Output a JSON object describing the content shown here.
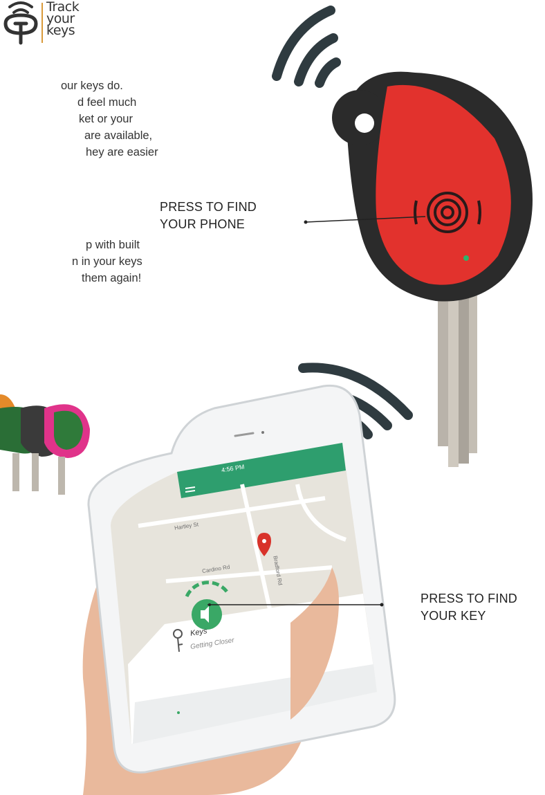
{
  "brand": {
    "lines": [
      "Track",
      "your",
      "keys"
    ],
    "accent": "#d99a3a"
  },
  "intro": {
    "paragraph1": [
      "our keys do.",
      "d feel much",
      "ket or your",
      "are available,",
      "hey are easier"
    ],
    "paragraph2": [
      "p with built",
      "n in your keys",
      "them again!"
    ]
  },
  "callouts": {
    "find_phone": [
      "PRESS TO FIND",
      "YOUR PHONE"
    ],
    "find_key": [
      "PRESS TO FIND",
      "YOUR KEY"
    ]
  },
  "phone_app": {
    "status_time": "4:56 PM",
    "map_labels": [
      "Hartley St",
      "Cardino Rd",
      "Bradford Rd"
    ],
    "item_title": "Keys",
    "item_status": "Getting Closer",
    "header_color": "#2e9e6e",
    "button_color": "#3aa866"
  },
  "colors": {
    "key_fob": "#e2322d",
    "wave": "#2f3b40",
    "fob_green": "#2f7a3a",
    "fob_pink": "#e0338a"
  },
  "icons": [
    "wifi-wave-icon",
    "speaker-icon",
    "key-icon",
    "map-pin-icon",
    "menu-icon",
    "more-vert-icon"
  ]
}
